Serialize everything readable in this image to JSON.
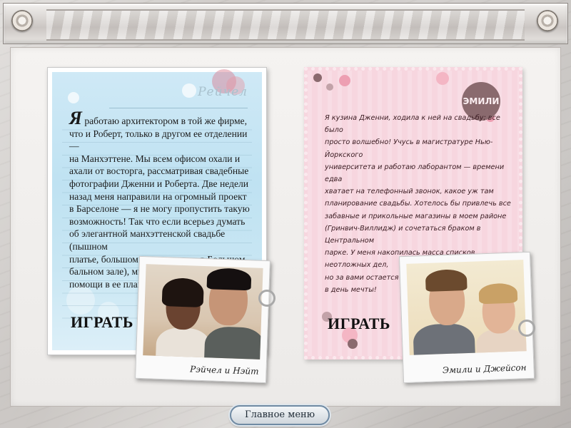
{
  "rachel_card": {
    "name": "Рейчел",
    "bio": "Я работаю архитектором в той же фирме,\nчто и Роберт, только в другом ее отделении —\nна Манхэттене. Мы всем офисом охали и\nахали от восторга, рассматривая свадебные\nфотографии Дженни и Роберта. Две недели\nназад меня направили на огромный проект\nв Барселоне — я не могу пропустить такую\nвозможность! Так что если всерьез думать\nоб элегантной манхэттенской свадьбе (пышном\nплатье, большом торте, приеме в Большом\nбальном зале), мне не обойтись без вашей\nпомощи в ее планировании.",
    "play_label": "ИГРАТЬ",
    "photo_caption": "Рэйчел и Нэйт"
  },
  "emily_card": {
    "badge": "ЭМИЛИ",
    "bio": "Я кузина Дженни, ходила к ней на свадьбу; все было\nпросто волшебно! Учусь в магистратуре Нью-Йоркского\nуниверситета и работаю лаборантом — времени едва\nхватает на телефонный звонок, какое уж там\nпланирование свадьбы. Хотелось бы привлечь все\nзабавные и прикольные магазины в моем районе\n(Гринвич-Виллидж) и сочетаться браком в Центральном\nпарке. У меня накопилась масса списков неотложных дел,\nно за вами остается главное — превратить свадьбу\nв день мечты!",
    "play_label": "ИГРАТЬ",
    "photo_caption": "Эмили и Джейсон"
  },
  "footer": {
    "main_menu_label": "Главное меню"
  },
  "colors": {
    "rachel_card_bg": "#c8e6f3",
    "emily_card_bg": "#f7d6df",
    "menu_border": "#6f8aa3"
  }
}
